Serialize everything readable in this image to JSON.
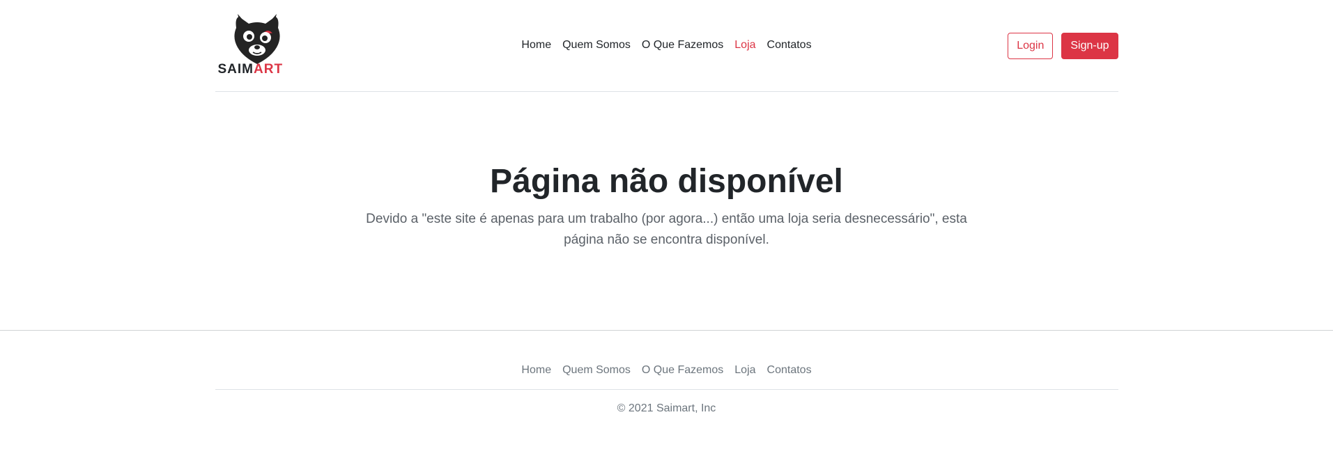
{
  "header": {
    "logo": {
      "word_dark": "SAIM",
      "word_red": "ART",
      "icon": "wolf-head-logo-icon"
    },
    "nav": [
      {
        "label": "Home",
        "active": false
      },
      {
        "label": "Quem Somos",
        "active": false
      },
      {
        "label": "O Que Fazemos",
        "active": false
      },
      {
        "label": "Loja",
        "active": true
      },
      {
        "label": "Contatos",
        "active": false
      }
    ],
    "login_label": "Login",
    "signup_label": "Sign-up"
  },
  "main": {
    "title": "Página não disponível",
    "description": "Devido a \"este site é apenas para um trabalho (por agora...) então uma loja seria desnecessário\", esta página não se encontra disponível."
  },
  "footer": {
    "nav": [
      {
        "label": "Home"
      },
      {
        "label": "Quem Somos"
      },
      {
        "label": "O Que Fazemos"
      },
      {
        "label": "Loja"
      },
      {
        "label": "Contatos"
      }
    ],
    "copyright": "© 2021 Saimart, Inc"
  },
  "colors": {
    "accent": "#dc3545",
    "text": "#212529",
    "muted": "#6c757d"
  }
}
